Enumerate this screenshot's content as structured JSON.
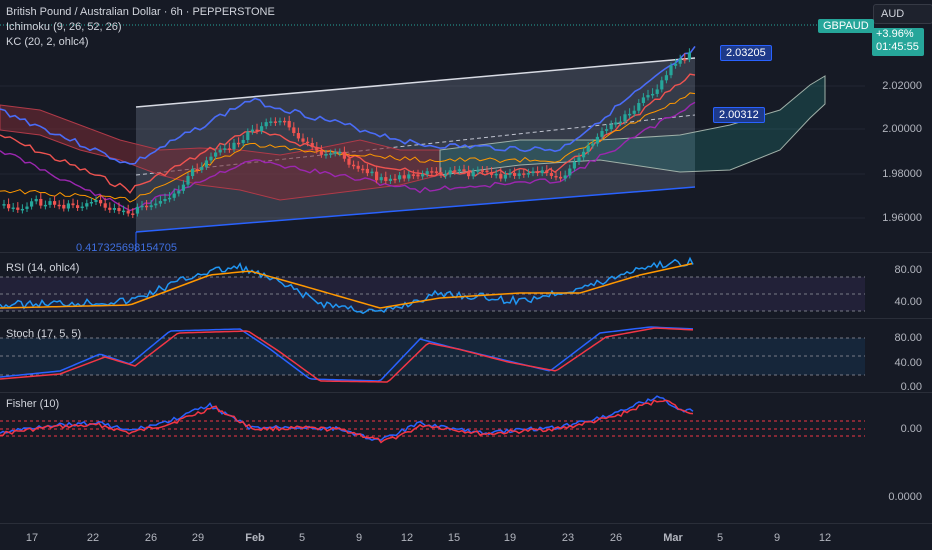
{
  "header": {
    "symbol_title": "British Pound / Australian Dollar · 6h · PEPPERSTONE",
    "indicator_1": "Ichimoku (9, 26, 52, 26)",
    "indicator_2": "KC (20, 2, ohlc4)"
  },
  "currency_button": "AUD",
  "price_tag": {
    "symbol": "GBPAUD",
    "change": "+3.96%",
    "countdown": "01:45:55"
  },
  "callouts": {
    "upper": "2.03205",
    "lower": "2.00312"
  },
  "fib_label": "0.417325698154705",
  "main_axis": [
    "2.02000",
    "2.00000",
    "1.98000",
    "1.96000"
  ],
  "rsi": {
    "label": "RSI (14, ohlc4)",
    "ticks": [
      "80.00",
      "40.00"
    ]
  },
  "stoch": {
    "label": "Stoch (17, 5, 5)",
    "ticks": [
      "80.00",
      "40.00",
      "0.00"
    ]
  },
  "fisher": {
    "label": "Fisher (10)",
    "ticks": [
      "0.00",
      "0.0000"
    ]
  },
  "x_axis": [
    "17",
    "22",
    "26",
    "29",
    "Feb",
    "5",
    "9",
    "12",
    "15",
    "19",
    "23",
    "26",
    "Mar",
    "5",
    "9",
    "12"
  ],
  "colors": {
    "up": "#26a69a",
    "down": "#ef5350",
    "blue_line": "#2962ff",
    "kc_line": "#4a6cf7",
    "rsi_line": "#2196f3",
    "rsi_ma": "#ff9800",
    "stoch_k": "#2962ff",
    "stoch_d": "#f23645"
  }
}
